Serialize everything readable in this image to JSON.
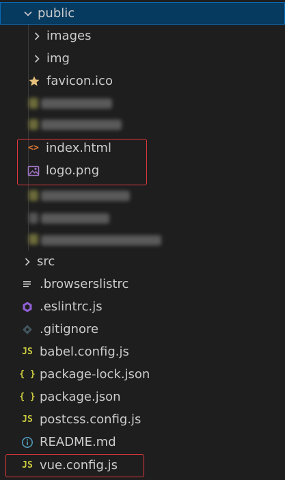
{
  "explorer": {
    "public_folder": {
      "label": "public"
    },
    "public_children": {
      "images": "images",
      "img": "img",
      "favicon": "favicon.ico",
      "index_html": "index.html",
      "logo": "logo.png"
    },
    "root_items": {
      "src": "src",
      "browserslistrc": ".browserslistrc",
      "eslintrc": ".eslintrc.js",
      "gitignore": ".gitignore",
      "babel_config": "babel.config.js",
      "package_lock": "package-lock.json",
      "package_json": "package.json",
      "postcss_config": "postcss.config.js",
      "readme": "README.md",
      "vue_config": "vue.config.js"
    },
    "icon_glyphs": {
      "js": "JS",
      "json": "{ }",
      "html": "<>"
    },
    "colors": {
      "background": "#1e1e1e",
      "selected_bg": "#073a5f",
      "text": "#cccccc",
      "js_yellow": "#cbcb41",
      "html_orange": "#e37933",
      "image_purple": "#a074c4",
      "eslint_purple": "#8f5fd4",
      "info_blue": "#519aba",
      "highlight_red": "#e0383e"
    }
  }
}
